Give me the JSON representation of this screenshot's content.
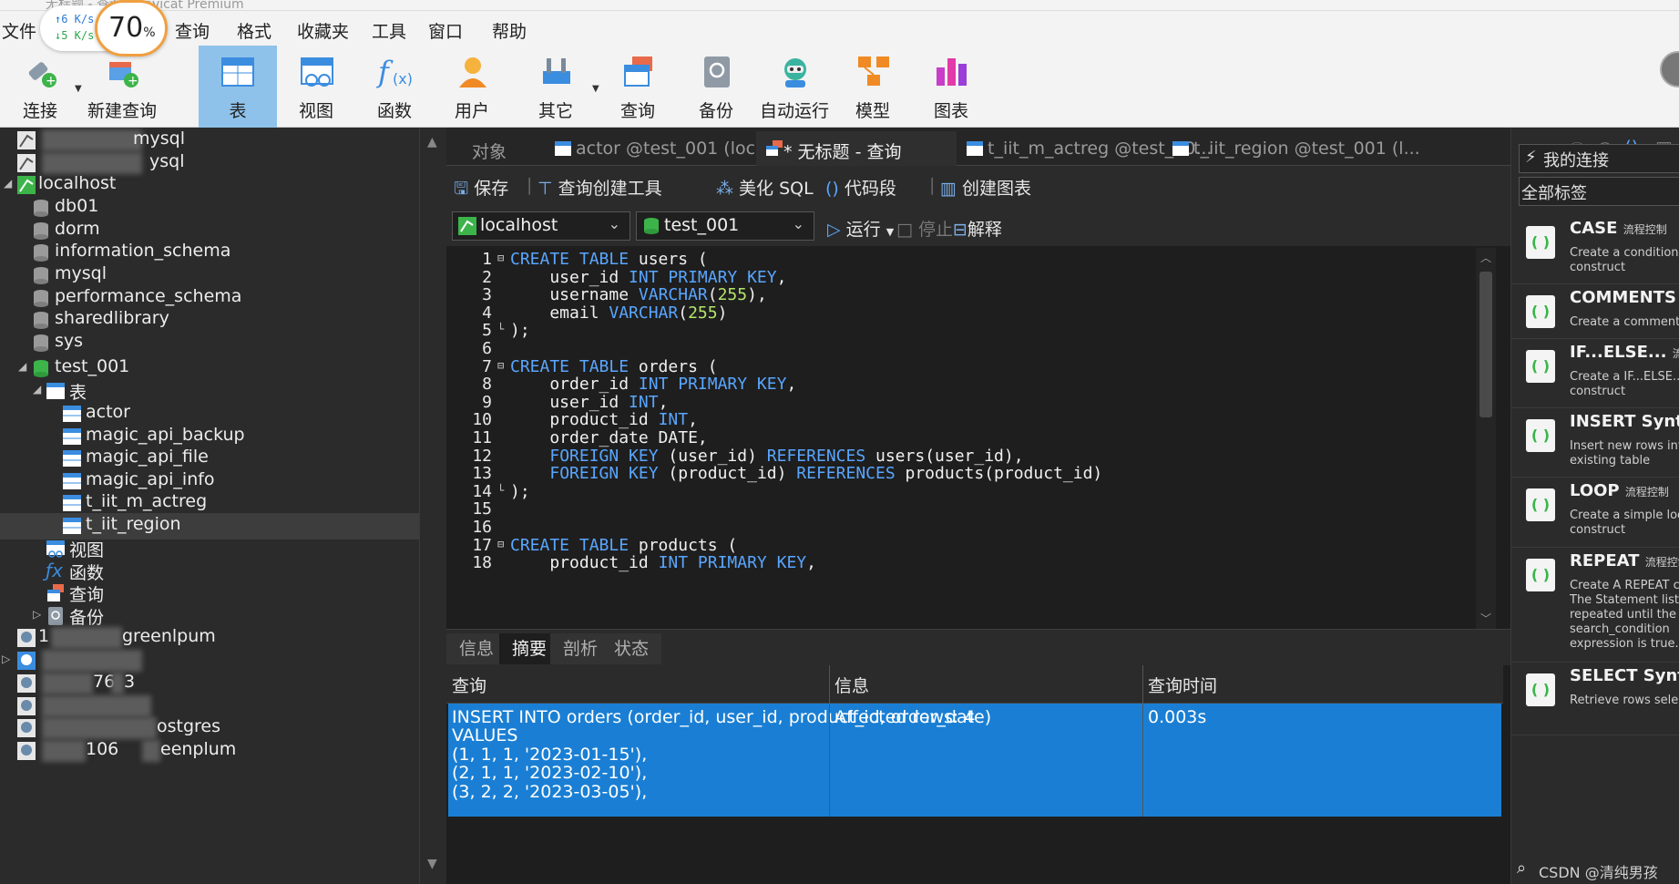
{
  "window": {
    "title_partial": "无标题 - 查询 - Navicat Premium"
  },
  "speed_widget": {
    "up": "6 K/s",
    "down": "5 K/s",
    "percent": "70",
    "percent_unit": "%"
  },
  "menu": [
    "文件",
    "查询",
    "格式",
    "收藏夹",
    "工具",
    "窗口",
    "帮助"
  ],
  "toolbar": [
    {
      "label": "连接",
      "icon": "plug-icon"
    },
    {
      "label": "新建查询",
      "icon": "new-query-icon"
    },
    {
      "label": "表",
      "icon": "table-icon",
      "active": true
    },
    {
      "label": "视图",
      "icon": "view-icon"
    },
    {
      "label": "函数",
      "icon": "function-icon"
    },
    {
      "label": "用户",
      "icon": "user-icon"
    },
    {
      "label": "其它",
      "icon": "tools-icon"
    },
    {
      "label": "查询",
      "icon": "query-icon"
    },
    {
      "label": "备份",
      "icon": "backup-icon"
    },
    {
      "label": "自动运行",
      "icon": "robot-icon"
    },
    {
      "label": "模型",
      "icon": "model-icon"
    },
    {
      "label": "图表",
      "icon": "chart-icon"
    }
  ],
  "tree": {
    "conn1_suffix": "mysql",
    "conn2_suffix": "ysql",
    "localhost": "localhost",
    "dbs": [
      "db01",
      "dorm",
      "information_schema",
      "mysql",
      "performance_schema",
      "sharedlibrary",
      "sys",
      "test_001"
    ],
    "tables_group": "表",
    "tables": [
      "actor",
      "magic_api_backup",
      "magic_api_file",
      "magic_api_info",
      "t_iit_m_actreg",
      "t_iit_region"
    ],
    "other_groups": [
      "视图",
      "函数",
      "查询",
      "备份"
    ],
    "pg_partial": [
      "greenlpum",
      "76.",
      "3",
      "ostgres",
      "eenplum",
      "106"
    ],
    "pg_prefix": "1"
  },
  "tabs": [
    {
      "label": "对象"
    },
    {
      "label": "actor @test_001 (localh..."
    },
    {
      "label": "* 无标题 - 查询",
      "active": true
    },
    {
      "label": "t_iit_m_actreg @test_00..."
    },
    {
      "label": "t_iit_region @test_001 (l..."
    }
  ],
  "editor_toolbar": {
    "save": "保存",
    "builder": "查询创建工具",
    "beautify": "美化 SQL",
    "snippet": "代码段",
    "chart": "创建图表"
  },
  "connection_bar": {
    "connection": "localhost",
    "database": "test_001",
    "run": "运行",
    "stop": "停止",
    "explain": "解释"
  },
  "code": [
    {
      "n": "1",
      "fold": "-",
      "t": [
        [
          "kw",
          "CREATE TABLE"
        ],
        [
          "",
          " users ("
        ]
      ]
    },
    {
      "n": "2",
      "t": [
        [
          "",
          "    user_id "
        ],
        [
          "kw",
          "INT PRIMARY KEY"
        ],
        [
          "",
          ","
        ]
      ]
    },
    {
      "n": "3",
      "t": [
        [
          "",
          "    username "
        ],
        [
          "kw",
          "VARCHAR"
        ],
        [
          "",
          "("
        ],
        [
          "num",
          "255"
        ],
        [
          "",
          "),"
        ]
      ]
    },
    {
      "n": "4",
      "t": [
        [
          "",
          "    email "
        ],
        [
          "kw",
          "VARCHAR"
        ],
        [
          "",
          "("
        ],
        [
          "num",
          "255"
        ],
        [
          "",
          ")"
        ]
      ]
    },
    {
      "n": "5",
      "fold": "end",
      "t": [
        [
          "",
          ");"
        ]
      ]
    },
    {
      "n": "6",
      "t": []
    },
    {
      "n": "7",
      "fold": "-",
      "t": [
        [
          "kw",
          "CREATE TABLE"
        ],
        [
          "",
          " orders ("
        ]
      ]
    },
    {
      "n": "8",
      "t": [
        [
          "",
          "    order_id "
        ],
        [
          "kw",
          "INT PRIMARY KEY"
        ],
        [
          "",
          ","
        ]
      ]
    },
    {
      "n": "9",
      "t": [
        [
          "",
          "    user_id "
        ],
        [
          "kw",
          "INT"
        ],
        [
          "",
          ","
        ]
      ]
    },
    {
      "n": "10",
      "t": [
        [
          "",
          "    product_id "
        ],
        [
          "kw",
          "INT"
        ],
        [
          "",
          ","
        ]
      ]
    },
    {
      "n": "11",
      "t": [
        [
          "",
          "    order_date DATE,"
        ]
      ]
    },
    {
      "n": "12",
      "t": [
        [
          "",
          "    "
        ],
        [
          "kw",
          "FOREIGN KEY"
        ],
        [
          "",
          " (user_id) "
        ],
        [
          "kw",
          "REFERENCES"
        ],
        [
          "",
          " users(user_id),"
        ]
      ]
    },
    {
      "n": "13",
      "t": [
        [
          "",
          "    "
        ],
        [
          "kw",
          "FOREIGN KEY"
        ],
        [
          "",
          " (product_id) "
        ],
        [
          "kw",
          "REFERENCES"
        ],
        [
          "",
          " products(product_id)"
        ]
      ]
    },
    {
      "n": "14",
      "fold": "end",
      "t": [
        [
          "",
          ");"
        ]
      ]
    },
    {
      "n": "15",
      "t": []
    },
    {
      "n": "16",
      "t": []
    },
    {
      "n": "17",
      "fold": "-",
      "t": [
        [
          "kw",
          "CREATE TABLE"
        ],
        [
          "",
          " products ("
        ]
      ]
    },
    {
      "n": "18",
      "t": [
        [
          "",
          "    product_id "
        ],
        [
          "kw",
          "INT PRIMARY KEY"
        ],
        [
          "",
          ","
        ]
      ]
    }
  ],
  "result_tabs": [
    "信息",
    "摘要",
    "剖析",
    "状态"
  ],
  "result": {
    "headers": [
      "查询",
      "信息",
      "查询时间"
    ],
    "query_lines": [
      "INSERT INTO orders (order_id, user_id, product_id, order_date)",
      "VALUES",
      "(1, 1, 1, '2023-01-15'),",
      "(2, 1, 1, '2023-02-10'),",
      "(3, 2, 2, '2023-03-05'),"
    ],
    "info": "Affected rows: 4",
    "time": "0.003s"
  },
  "right_panel": {
    "my_connection": "我的连接",
    "all_tags": "全部标签",
    "snippets": [
      {
        "title": "CASE",
        "tag": "流程控制",
        "desc": [
          "Create a conditional",
          "construct"
        ]
      },
      {
        "title": "COMMENTS",
        "tag": "",
        "desc": [
          "Create a comment"
        ]
      },
      {
        "title": "IF...ELSE...",
        "tag": "流程控制",
        "desc": [
          "Create a IF...ELSE...",
          "construct"
        ]
      },
      {
        "title": "INSERT Syntax",
        "tag": "",
        "desc": [
          "Insert new rows into",
          "existing table"
        ]
      },
      {
        "title": "LOOP",
        "tag": "流程控制",
        "desc": [
          "Create a simple loop",
          "construct"
        ]
      },
      {
        "title": "REPEAT",
        "tag": "流程控制",
        "desc": [
          "Create A REPEAT co",
          "The Statement list is",
          "repeated until the",
          "search_condition",
          "expression is true."
        ]
      },
      {
        "title": "SELECT Syntax",
        "tag": "",
        "desc": [
          "Retrieve rows select"
        ]
      }
    ],
    "watermark": "CSDN @清纯男孩"
  },
  "colors": {
    "selection": "#1a7fd4",
    "keyword": "#59a6ff",
    "number": "#b5e56b",
    "toolbar_active": "#8ec2ea"
  }
}
